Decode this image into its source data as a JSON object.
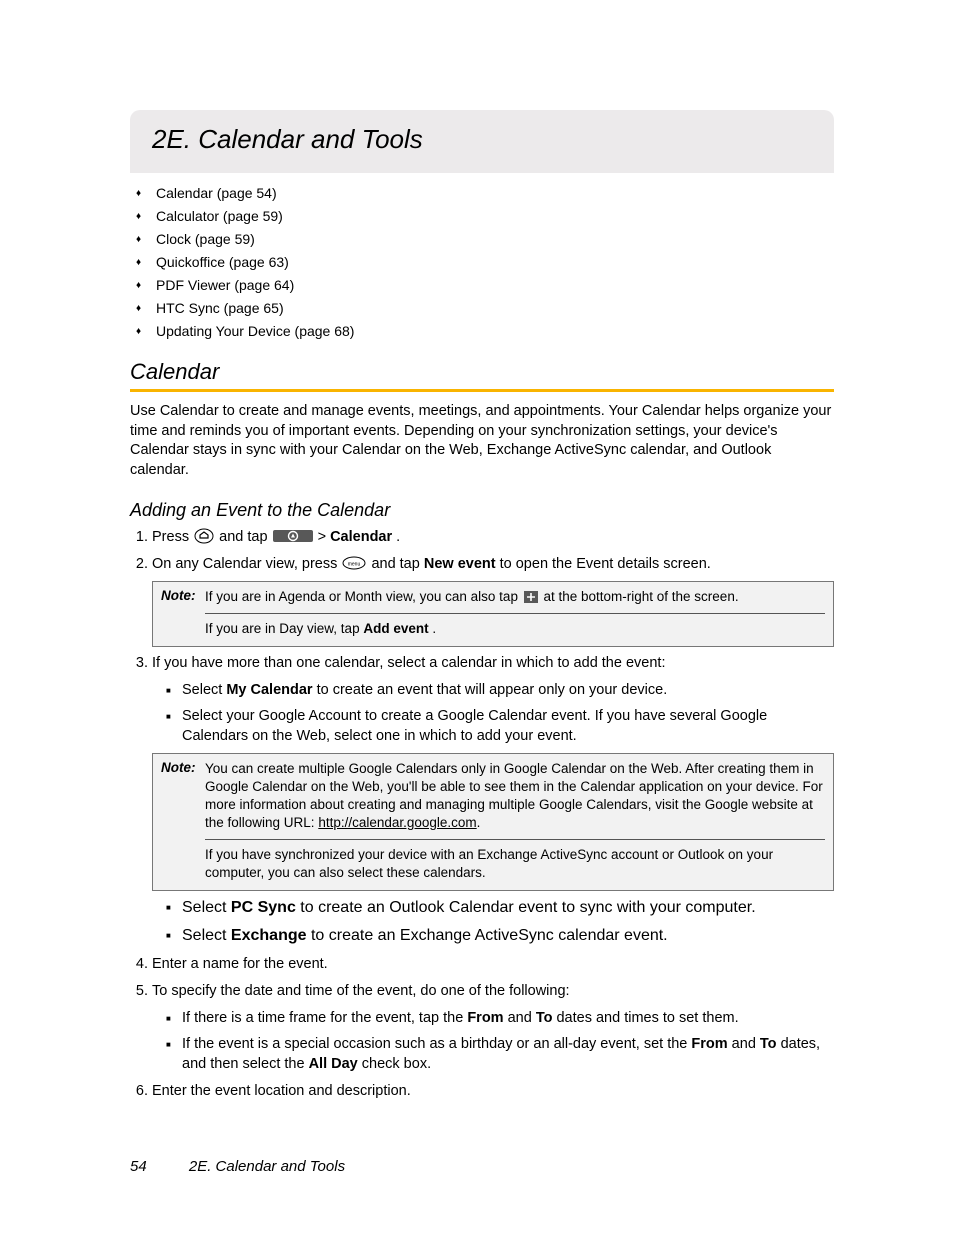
{
  "chapter": {
    "title": "2E. Calendar and Tools"
  },
  "toc": [
    "Calendar (page 54)",
    "Calculator (page 59)",
    "Clock (page 59)",
    "Quickoffice (page 63)",
    "PDF Viewer (page 64)",
    "HTC Sync (page 65)",
    "Updating Your Device (page 68)"
  ],
  "section": {
    "title": "Calendar",
    "intro": "Use Calendar to create and manage events, meetings, and appointments. Your Calendar helps organize your time and reminds you of important events. Depending on your synchronization settings, your device's Calendar stays in sync with your Calendar on the Web, Exchange ActiveSync calendar, and Outlook calendar."
  },
  "subsection": {
    "title": "Adding an Event to the Calendar",
    "step1": {
      "a": "Press ",
      "b": " and tap ",
      "c": " > ",
      "d": "Calendar",
      "e": "."
    },
    "step2": {
      "a": "On any Calendar view, press ",
      "b": " and tap ",
      "c": "New event",
      "d": " to open the Event details screen."
    },
    "note1": {
      "label": "Note:",
      "line1a": "If you are in Agenda or Month view, you can also tap ",
      "line1b": " at the bottom-right of the screen.",
      "line2a": "If you are in Day view, tap ",
      "line2b": "Add event",
      "line2c": "."
    },
    "step3": "If you have more than one calendar, select a calendar in which to add the event:",
    "step3sub": {
      "i1a": "Select ",
      "i1b": "My Calendar",
      "i1c": " to create an event that will appear only on your device.",
      "i2": "Select your Google Account to create a Google Calendar event. If you have several Google Calendars on the Web, select one in which to add your event."
    },
    "note2": {
      "label": "Note:",
      "line1": "You can create multiple Google Calendars only in Google Calendar on the Web. After creating them in Google Calendar on the Web, you'll be able to see them in the Calendar application on your device. For more information about creating and managing multiple Google Calendars, visit the Google website at the following URL: ",
      "url": "http://calendar.google.com",
      "dot": ".",
      "line2": "If you have synchronized your device with an Exchange ActiveSync account or Outlook on your computer, you can also select these calendars."
    },
    "step3sub2": {
      "i1a": "Select ",
      "i1b": "PC Sync",
      "i1c": " to create an Outlook Calendar event to sync with your computer.",
      "i2a": "Select ",
      "i2b": "Exchange",
      "i2c": " to create an Exchange ActiveSync calendar event."
    },
    "step4": "Enter a name for the event.",
    "step5": "To specify the date and time of the event, do one of the following:",
    "step5sub": {
      "i1a": "If there is a time frame for the event, tap the ",
      "i1b": "From",
      "i1c": " and ",
      "i1d": "To",
      "i1e": " dates and times to set them.",
      "i2a": "If the event is a special occasion such as a birthday or an all-day event, set the ",
      "i2b": "From",
      "i2c": " and ",
      "i2d": "To",
      "i2e": " dates, and then select the ",
      "i2f": "All Day",
      "i2g": " check box."
    },
    "step6": "Enter the event location and description."
  },
  "footer": {
    "page": "54",
    "title": "2E. Calendar and Tools"
  }
}
